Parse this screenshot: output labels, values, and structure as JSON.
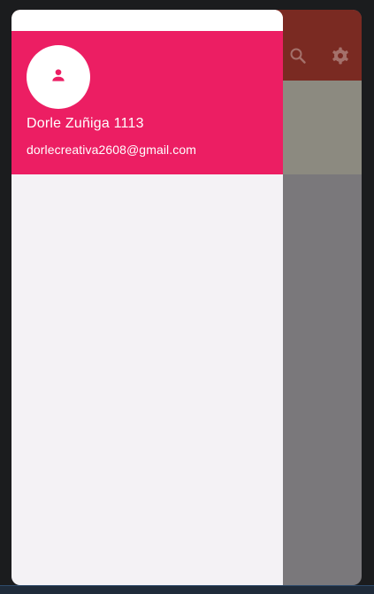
{
  "drawer": {
    "account_name": "Dorle Zuñiga 1113",
    "account_email": "dorlecreativa2608@gmail.com",
    "avatar_icon": "person-icon"
  },
  "appbar": {
    "icons": [
      "search-icon",
      "settings-icon"
    ]
  },
  "colors": {
    "drawer_header": "#ec1e63",
    "appbar_scrimmed": "#7a2a22",
    "drawer_body": "#f4f2f5"
  }
}
